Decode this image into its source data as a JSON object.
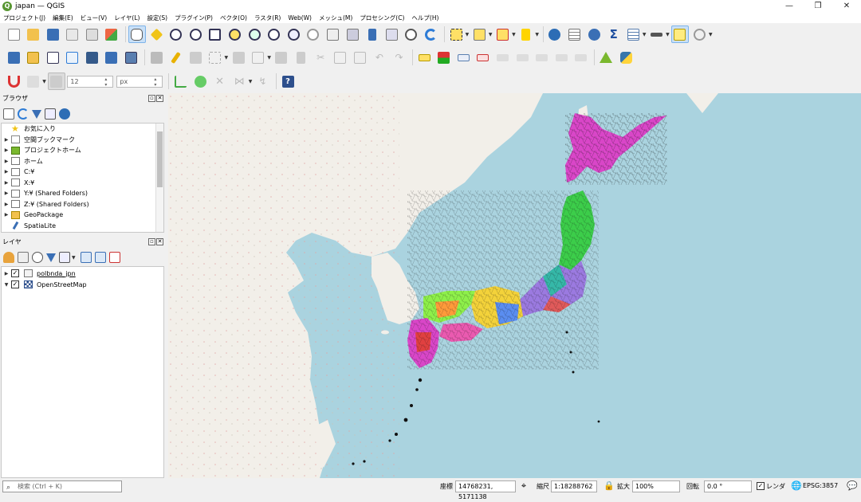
{
  "window": {
    "title": "japan — QGIS",
    "icon_letter": "Q",
    "minimize": "—",
    "maximize": "❐",
    "close": "✕"
  },
  "menu": [
    "プロジェクト(J)",
    "編集(E)",
    "ビュー(V)",
    "レイヤ(L)",
    "設定(S)",
    "プラグイン(P)",
    "ベクタ(O)",
    "ラスタ(R)",
    "Web(W)",
    "メッシュ(M)",
    "プロセシング(C)",
    "ヘルプ(H)"
  ],
  "toolbar": {
    "snap_tolerance": "12",
    "snap_unit": "px"
  },
  "browser_panel": {
    "title": "ブラウザ",
    "items": [
      {
        "label": "お気に入り",
        "icon": "star-icon",
        "expandable": false
      },
      {
        "label": "空間ブックマーク",
        "icon": "bookmark-icon",
        "expandable": true
      },
      {
        "label": "プロジェクトホーム",
        "icon": "project-home-icon",
        "expandable": true
      },
      {
        "label": "ホーム",
        "icon": "home-folder-icon",
        "expandable": true
      },
      {
        "label": "C:¥",
        "icon": "folder-icon",
        "expandable": true
      },
      {
        "label": "X:¥",
        "icon": "folder-icon",
        "expandable": true
      },
      {
        "label": "Y:¥ (Shared Folders)",
        "icon": "folder-icon",
        "expandable": true
      },
      {
        "label": "Z:¥ (Shared Folders)",
        "icon": "folder-icon",
        "expandable": true
      },
      {
        "label": "GeoPackage",
        "icon": "geopackage-icon",
        "expandable": true
      },
      {
        "label": "SpatiaLite",
        "icon": "spatialite-icon",
        "expandable": false
      }
    ]
  },
  "layers_panel": {
    "title": "レイヤ",
    "layers": [
      {
        "label": "polbnda_jpn",
        "checked": true,
        "icon": "polygon-layer-icon"
      },
      {
        "label": "OpenStreetMap",
        "checked": true,
        "icon": "raster-layer-icon"
      }
    ]
  },
  "statusbar": {
    "search_placeholder": "検索 (Ctrl + K)",
    "coord_label": "座標",
    "coord_value": "14768231, 5171138",
    "scale_label": "縮尺",
    "scale_value": "1:18288762",
    "magnifier_label": "拡大",
    "magnifier_value": "100%",
    "rotation_label": "回転",
    "rotation_value": "0.0 °",
    "render_label": "レンダ",
    "crs_label": "EPSG:3857"
  },
  "colors": {
    "sea": "#aad3df",
    "land": "#f2efe9",
    "hokkaido": "#d946c8",
    "tohoku": "#3ccd4a",
    "qgis_green": "#589632"
  }
}
